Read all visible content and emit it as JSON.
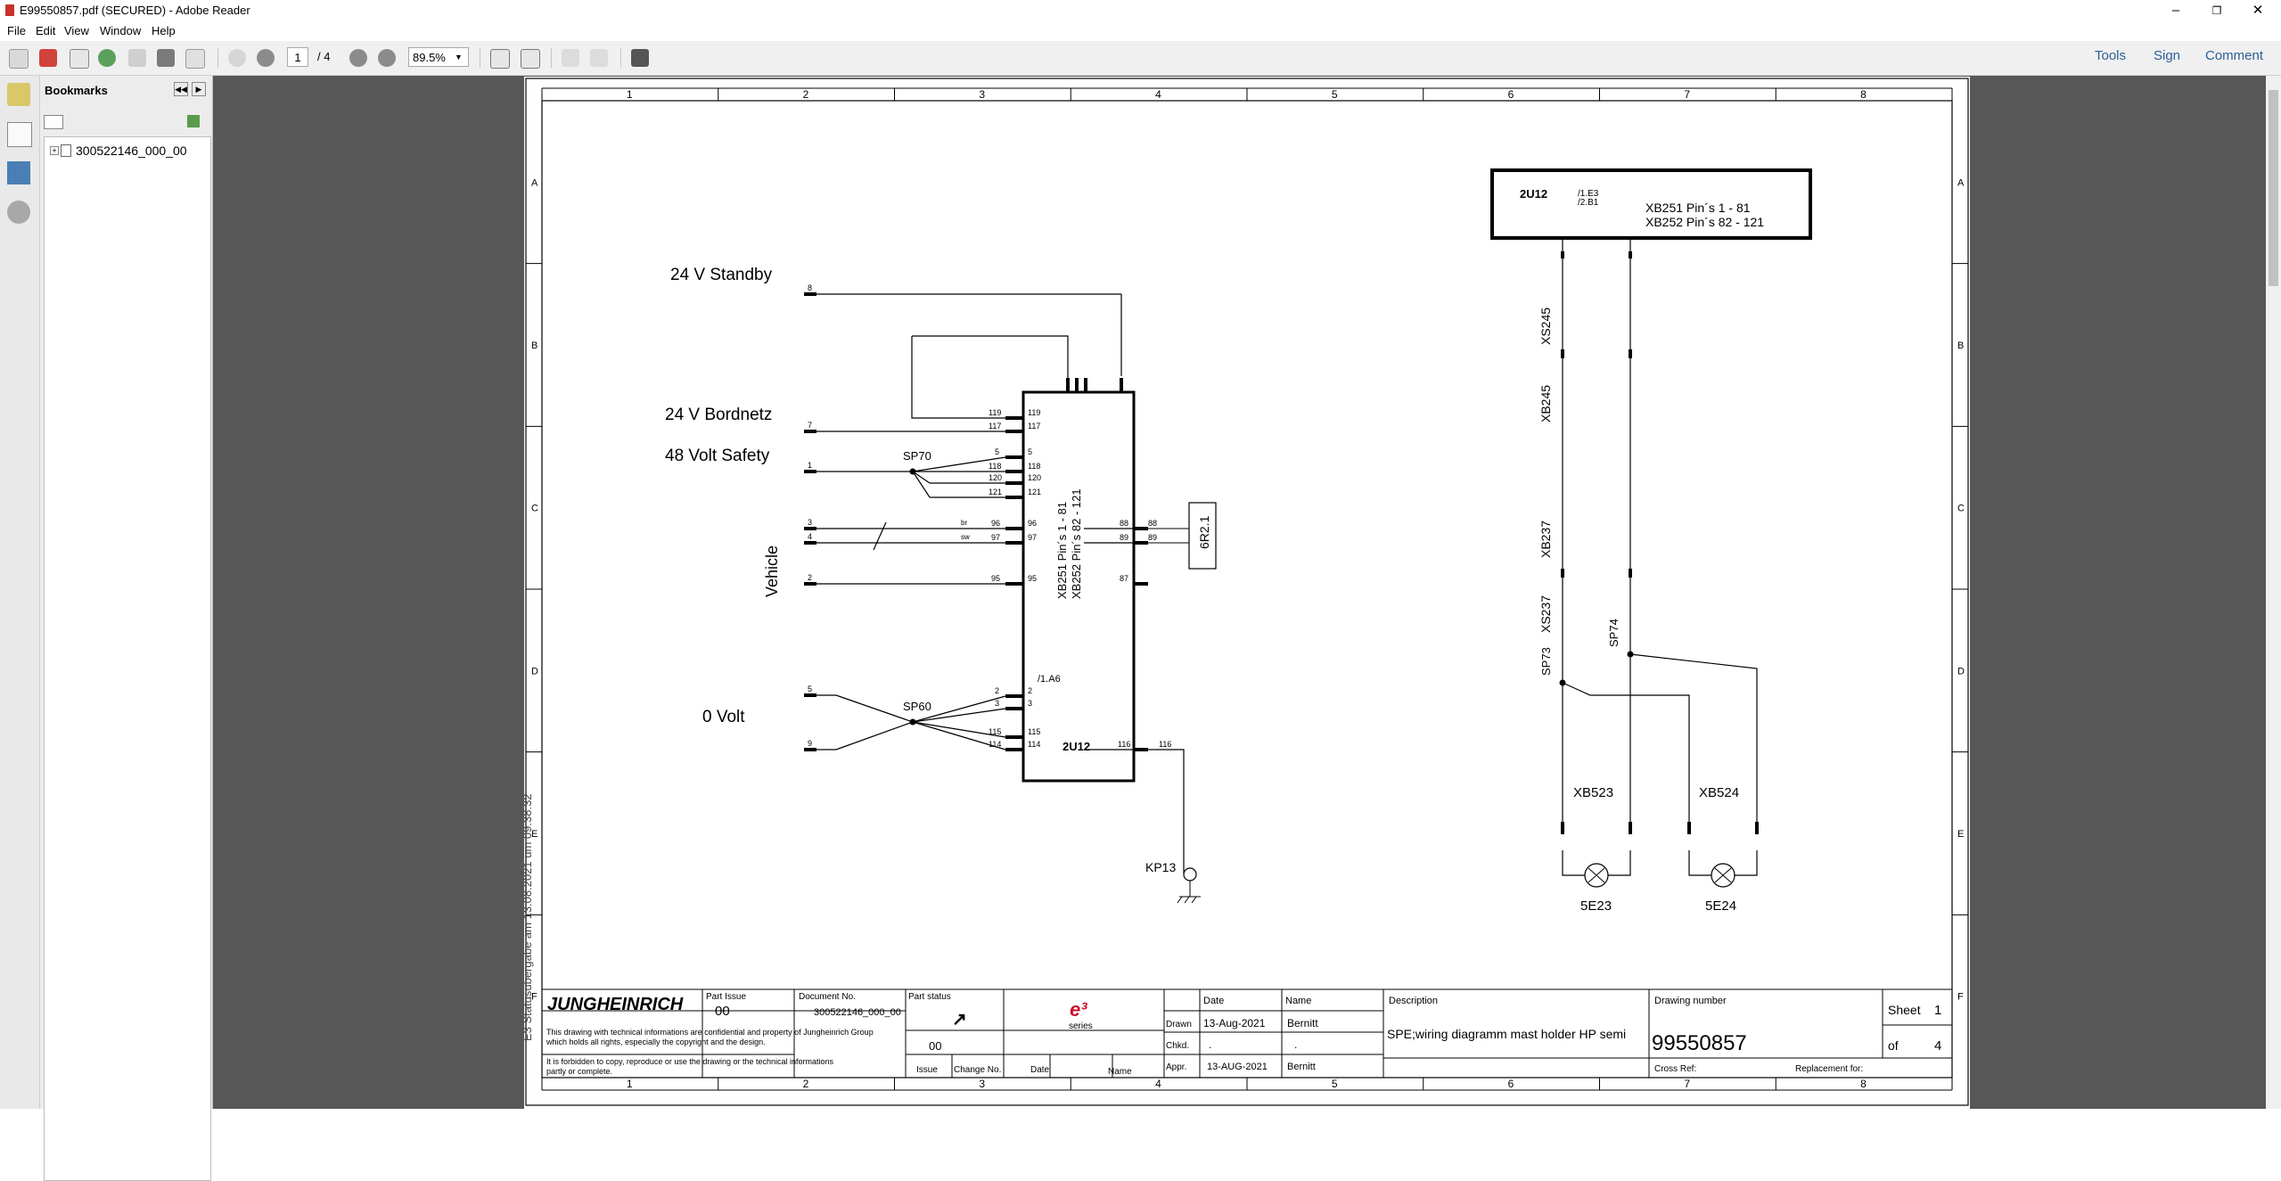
{
  "window": {
    "title": "E99550857.pdf (SECURED) - Adobe Reader",
    "controls": {
      "minimize": "–",
      "restore": "❐",
      "close": "✕"
    }
  },
  "menu": {
    "items": [
      "File",
      "Edit",
      "View",
      "Window",
      "Help"
    ]
  },
  "toolbar": {
    "page_current": "1",
    "page_total": "/ 4",
    "zoom": "89.5%",
    "right": {
      "tools": "Tools",
      "sign": "Sign",
      "comment": "Comment"
    },
    "icons": [
      "create-pdf-icon",
      "export-pdf-icon",
      "edit-icon",
      "cloud-icon",
      "save-icon",
      "print-icon",
      "email-icon",
      "prev-page-icon",
      "next-page-icon",
      "zoom-out-icon",
      "zoom-in-icon",
      "fit-page-icon",
      "fit-width-icon",
      "rotate-left-icon",
      "rotate-right-icon",
      "read-mode-icon"
    ]
  },
  "bookmarks": {
    "title": "Bookmarks",
    "items": [
      {
        "label": "300522146_000_00"
      }
    ]
  },
  "drawing": {
    "columns": [
      "1",
      "2",
      "3",
      "4",
      "5",
      "6",
      "7",
      "8"
    ],
    "rows": [
      "A",
      "B",
      "C",
      "D",
      "E",
      "F"
    ],
    "side_stamp": "E3 Statusübergabe am 13:08:2021 um 09:38:32",
    "labels": {
      "standby": "24 V Standby",
      "bordnetz": "24 V Bordnetz",
      "safety": "48 Volt Safety",
      "vehicle": "Vehicle",
      "zero_volt": "0 Volt",
      "sp70": "SP70",
      "sp60": "SP60",
      "ecu": "2U12",
      "ecu_ref": "/1.A6",
      "xb251": "XB251 Pin´s 1 - 81",
      "xb252": "XB252 Pin´s 82 - 121",
      "kp13": "KP13",
      "r2": "6R2.1",
      "box_name": "2U12",
      "box_ref1": "/1.E3",
      "box_ref2": "/2.B1",
      "box_xb251": "XB251 Pin´s 1 - 81",
      "box_xb252": "XB252 Pin´s 82 - 121",
      "xs245": "XS245",
      "xb245": "XB245",
      "xb237": "XB237",
      "xs237": "XS237",
      "sp73": "SP73",
      "sp74": "SP74",
      "xb523": "XB523",
      "xb524": "XB524",
      "e23": "5E23",
      "e24": "5E24",
      "wire_br": "br",
      "wire_sw": "sw"
    },
    "title_block": {
      "logo": "JUNGHEINRICH",
      "confidential_1": "This drawing with technical informations are confidential and property of Jungheinrich Group",
      "confidential_2": "which holds all rights, especially the copyright and the design.",
      "confidential_3": "It is forbidden to copy, reproduce or use the drawing or the technical informations",
      "confidential_4": "partly or complete.",
      "part_issue_label": "Part Issue",
      "part_issue": "00",
      "document_no_label": "Document No.",
      "document_no": "300522146_000_00",
      "part_status_label": "Part status",
      "issue_value": "00",
      "issue": "Issue",
      "change_no": "Change No.",
      "date_col": "Date",
      "name_col": "Name",
      "e3_series": "series",
      "drawn": "Drawn",
      "chkd": "Chkd.",
      "appr": "Appr.",
      "date_label": "Date",
      "name_label": "Name",
      "drawn_date": "13-Aug-2021",
      "drawn_name": "Bernitt",
      "chkd_date": ".",
      "chkd_name": ".",
      "appr_date": "13-AUG-2021",
      "appr_name": "Bernitt",
      "description_label": "Description",
      "description": "SPE;wiring diagramm mast holder HP semi",
      "drawing_number_label": "Drawing number",
      "drawing_number": "99550857",
      "sheet_label": "Sheet",
      "sheet": "1",
      "of_label": "of",
      "of": "4",
      "cross_ref": "Cross Ref:",
      "replacement": "Replacement for:"
    }
  }
}
